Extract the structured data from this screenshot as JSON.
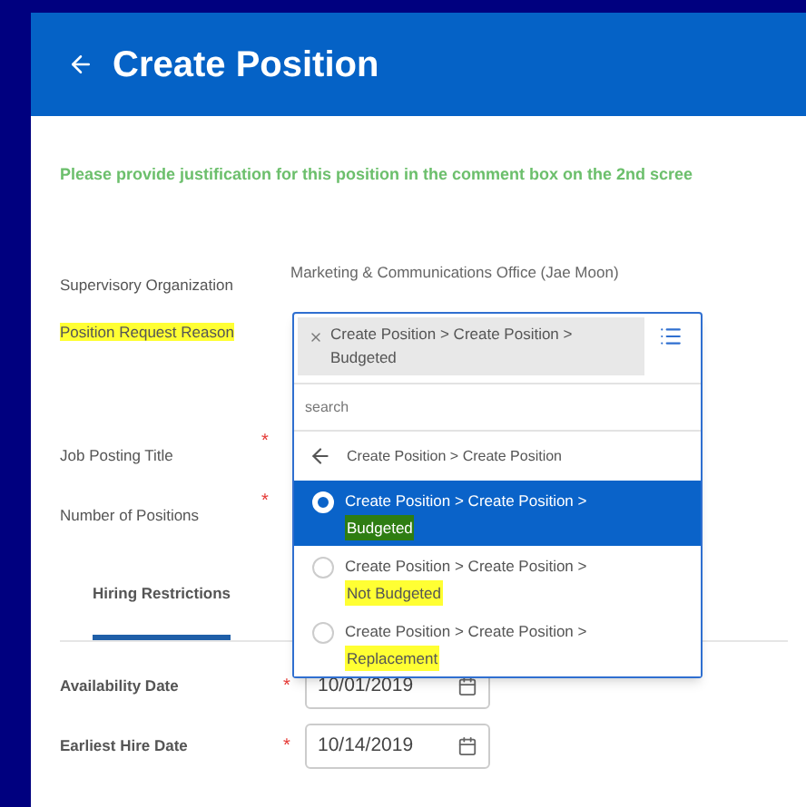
{
  "header": {
    "title": "Create Position"
  },
  "notice": "Please provide justification for this position in the comment box on the 2nd scree",
  "fields": [
    {
      "label": "Supervisory Organization",
      "value": "Marketing & Communications Office (Jae Moon)",
      "highlighted": false
    },
    {
      "label": "Position Request Reason",
      "highlighted": true
    },
    {
      "label": "Job Posting Title",
      "required_mark": "*",
      "highlighted": false
    },
    {
      "label": "Number of Positions",
      "required_mark": "*",
      "highlighted": false
    }
  ],
  "tabs": [
    {
      "label": "Hiring Restrictions",
      "selected": true
    }
  ],
  "date_fields": [
    {
      "label": "Availability Date",
      "value": "10/01/2019",
      "required_mark": "*"
    },
    {
      "label": "Earliest Hire Date",
      "value": "10/14/2019",
      "required_mark": "*"
    }
  ],
  "dropdown": {
    "chip": "Create Position > Create Position > Budgeted",
    "search_placeholder": "search",
    "back": "Create Position > Create Position",
    "options": [
      {
        "path": "Create Position > Create Position >",
        "leaf": "Budgeted",
        "color": "#2e7d12",
        "selected": true
      },
      {
        "path": "Create Position > Create Position >",
        "leaf": "Not Budgeted",
        "color": "#ffff33",
        "selected": false
      },
      {
        "path": "Create Position > Create Position >",
        "leaf": "Replacement",
        "color": "#ffff33",
        "selected": false
      }
    ]
  }
}
